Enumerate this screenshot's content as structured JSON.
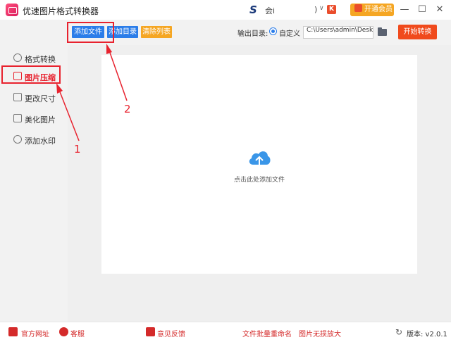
{
  "app": {
    "title": "优速图片格式转换器",
    "brand_glyph": "S",
    "user_text": "会i",
    "mid_text": ")",
    "dropdown_glyph": "∨",
    "k_glyph": "K",
    "vip_label": "开通会员",
    "minimize": "—",
    "maximize": "☐",
    "close": "✕"
  },
  "toolbar": {
    "add_file": "添加文件",
    "add_dir": "添加目录",
    "clear_list": "清除列表",
    "output_label": "输出目录:",
    "custom_label": "自定义",
    "path_value": "C:\\Users\\admin\\Deskto",
    "start": "开始转换",
    "colors": {
      "add_file": "#2b7de9",
      "add_dir": "#2b7de9",
      "clear_list": "#f5a623",
      "start": "#f04a1c"
    }
  },
  "sidebar": {
    "items": [
      {
        "label": "格式转换",
        "icon": "format-convert-icon",
        "active": false
      },
      {
        "label": "图片压缩",
        "icon": "compress-icon",
        "active": true
      },
      {
        "label": "更改尺寸",
        "icon": "resize-icon",
        "active": false
      },
      {
        "label": "美化图片",
        "icon": "beautify-icon",
        "active": false
      },
      {
        "label": "添加水印",
        "icon": "watermark-icon",
        "active": false
      }
    ]
  },
  "main": {
    "drop_text": "点击此处添加文件",
    "cloud_color": "#3a96e8"
  },
  "footer": {
    "official_site": "官方网址",
    "customer_service": "客服",
    "feedback": "意见反馈",
    "batch_rename": "文件批量重命名",
    "lossless_zoom": "图片无损放大",
    "version": "版本: v2.0.1",
    "refresh_glyph": "↻"
  },
  "annotations": {
    "label_1": "1",
    "label_2": "2",
    "color": "#e8222e"
  }
}
